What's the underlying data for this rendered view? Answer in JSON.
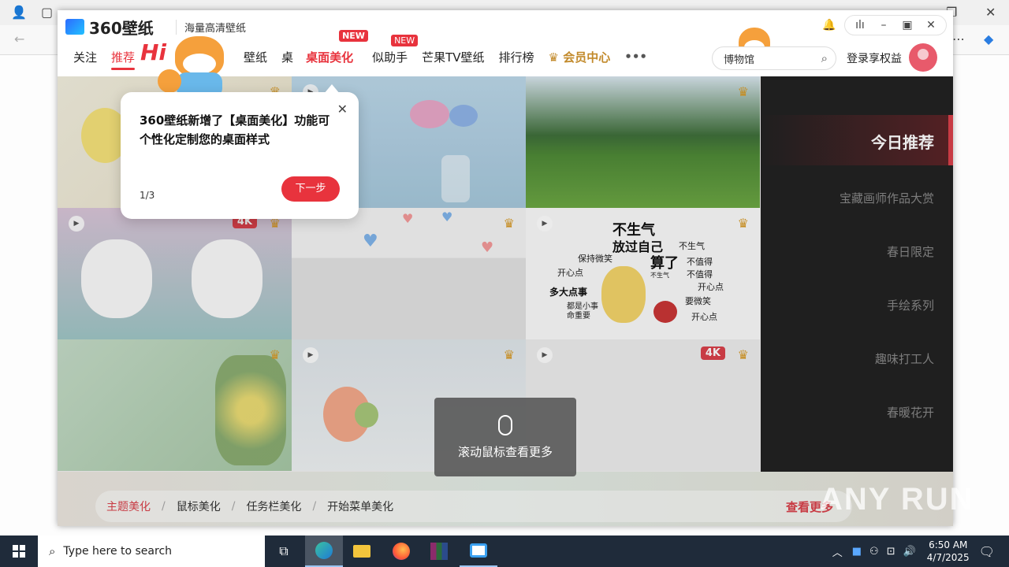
{
  "app": {
    "logo_text": "360壁纸",
    "subtitle": "海量高清壁纸",
    "nav": [
      {
        "label": "关注"
      },
      {
        "label": "推荐"
      },
      {
        "label": "壁纸"
      },
      {
        "label": "桌"
      },
      {
        "label": "桌面美化",
        "badge": "NEW"
      },
      {
        "label": "似助手",
        "badge": "NEW"
      },
      {
        "label": "芒果TV壁纸"
      },
      {
        "label": "排行榜"
      },
      {
        "label": "会员中心"
      },
      {
        "label": "•••"
      }
    ],
    "search_value": "博物馆",
    "login_label": "登录享权益"
  },
  "tooltip": {
    "text": "360壁纸新增了【桌面美化】功能可个性化定制您的桌面样式",
    "page": "1/3",
    "next_label": "下一步",
    "mascot_text": "Hi"
  },
  "tiles": {
    "badge_4k": "4K"
  },
  "sidebar": {
    "active": "今日推荐",
    "items": [
      "宝藏画师作品大赏",
      "春日限定",
      "手绘系列",
      "趣味打工人",
      "春暖花开"
    ]
  },
  "bottom": {
    "items": [
      "主题美化",
      "鼠标美化",
      "任务栏美化",
      "开始菜单美化"
    ],
    "separator": "/",
    "more": "查看更多"
  },
  "scroll_hint": "滚动鼠标查看更多",
  "sticker": {
    "title1": "不生气",
    "title2": "放过自己",
    "title3": "算了",
    "words": [
      "保持微笑",
      "开心点",
      "多大点事",
      "都是小事",
      "命重要",
      "不生气",
      "不值得",
      "不值得",
      "开心点",
      "要微笑",
      "开心点",
      "不生气"
    ]
  },
  "watermark": "ANY RUN",
  "taskbar": {
    "search_placeholder": "Type here to search",
    "time": "6:50 AM",
    "date": "4/7/2025"
  }
}
